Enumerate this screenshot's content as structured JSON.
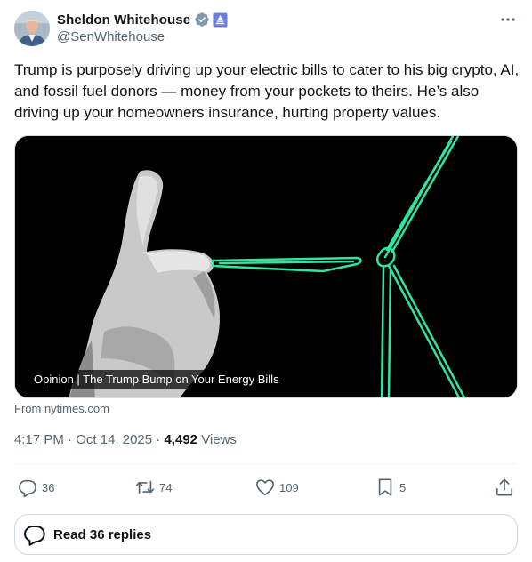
{
  "author": {
    "display_name": "Sheldon Whitehouse",
    "handle": "@SenWhitehouse"
  },
  "tweet": {
    "text": "Trump is purposely driving up your electric bills to cater to his big crypto, AI, and fossil fuel donors — money from your pockets to theirs. He’s also driving up your homeowners insurance, hurting property values."
  },
  "card": {
    "label": "Opinion | The Trump Bump on Your Energy Bills",
    "source": "From nytimes.com"
  },
  "meta": {
    "time": "4:17 PM",
    "date": "Oct 14, 2025",
    "views_count": "4,492",
    "views_label": "Views",
    "separator": "·"
  },
  "actions": {
    "replies": "36",
    "reposts": "74",
    "likes": "109",
    "bookmarks": "5"
  },
  "read_replies": {
    "label": "Read 36 replies"
  },
  "colors": {
    "text": "#0f1419",
    "secondary": "#536471",
    "verified": "#829aab",
    "gov_badge": "#6c7fd8",
    "turbine": "#2ee6a0"
  },
  "icons": [
    "verified-badge-icon",
    "government-badge-icon",
    "more-icon",
    "reply-icon",
    "repost-icon",
    "like-icon",
    "bookmark-icon",
    "share-icon",
    "replies-bubble-icon"
  ]
}
